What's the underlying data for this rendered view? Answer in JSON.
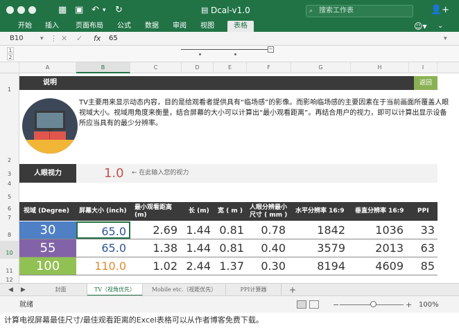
{
  "window": {
    "title": "Dcal-v1.0"
  },
  "search": {
    "placeholder": "搜索工作表"
  },
  "ribbon": {
    "tabs": [
      "开始",
      "插入",
      "页面布局",
      "公式",
      "数据",
      "审阅",
      "视图",
      "表格"
    ],
    "active_tab": "表格"
  },
  "formula_bar": {
    "name_box": "B10",
    "fx": "fx",
    "value": "65"
  },
  "outline": {
    "level1": "1",
    "level2": "2"
  },
  "columns": [
    "A",
    "B",
    "C",
    "D",
    "E",
    "F",
    "G",
    "H",
    "I"
  ],
  "rows": [
    "1",
    "2",
    "3",
    "4",
    "5",
    "6",
    "7",
    "8",
    "10",
    "11",
    "12"
  ],
  "sheet": {
    "header_label": "说明",
    "back_button": "返回",
    "description": "TV主要用来显示动态内容，目的是给观看者提供具有“临场感”的影像。而影响临场感的主要因素在于当前画面所覆盖人眼视域大小。视域用角度来衡量，结合屏幕的大小可以计算出“最小观看距离”。再结合用户的视力，即可以计算出显示设备所应当具有的最少分辨率。",
    "input_label": "人眼视力",
    "input_value": "1.0",
    "input_hint": "← 在此输入您的视力",
    "table_headers": [
      "视域 (Degree)",
      "屏幕大小 (inch)",
      "最小观看距离 (m)",
      "长 (m)",
      "宽 ( m )",
      "人眼分辨最小尺寸 ( mm )",
      "水平分辨率 16:9",
      "垂直分辨率 16:9",
      "PPI"
    ],
    "table_rows": [
      [
        "30",
        "65.0",
        "2.69",
        "1.44",
        "0.81",
        "0.78",
        "1842",
        "1036",
        "33"
      ],
      [
        "55",
        "65.0",
        "1.38",
        "1.44",
        "0.81",
        "0.40",
        "3579",
        "2013",
        "63"
      ],
      [
        "100",
        "110.0",
        "1.02",
        "2.44",
        "1.37",
        "0.30",
        "8194",
        "4609",
        "85"
      ]
    ],
    "row_colors": [
      "#4f7fc4",
      "#8263a8",
      "#92c153"
    ],
    "screen_size_colors": [
      "#2f5597",
      "#2f5597",
      "#e48a2e"
    ]
  },
  "sheet_tabs": [
    "封面",
    "TV（视角优先）",
    "Mobile etc.（视距优先）",
    "PPI计算器"
  ],
  "active_sheet": "TV（视角优先）",
  "status": {
    "text": "就绪",
    "zoom": "100%",
    "zoom_minus": "−",
    "zoom_plus": "+"
  },
  "caption": "计算电视屏幕最佳尺寸/最佳观看距离的Excel表格可以从作者博客免费下载。"
}
